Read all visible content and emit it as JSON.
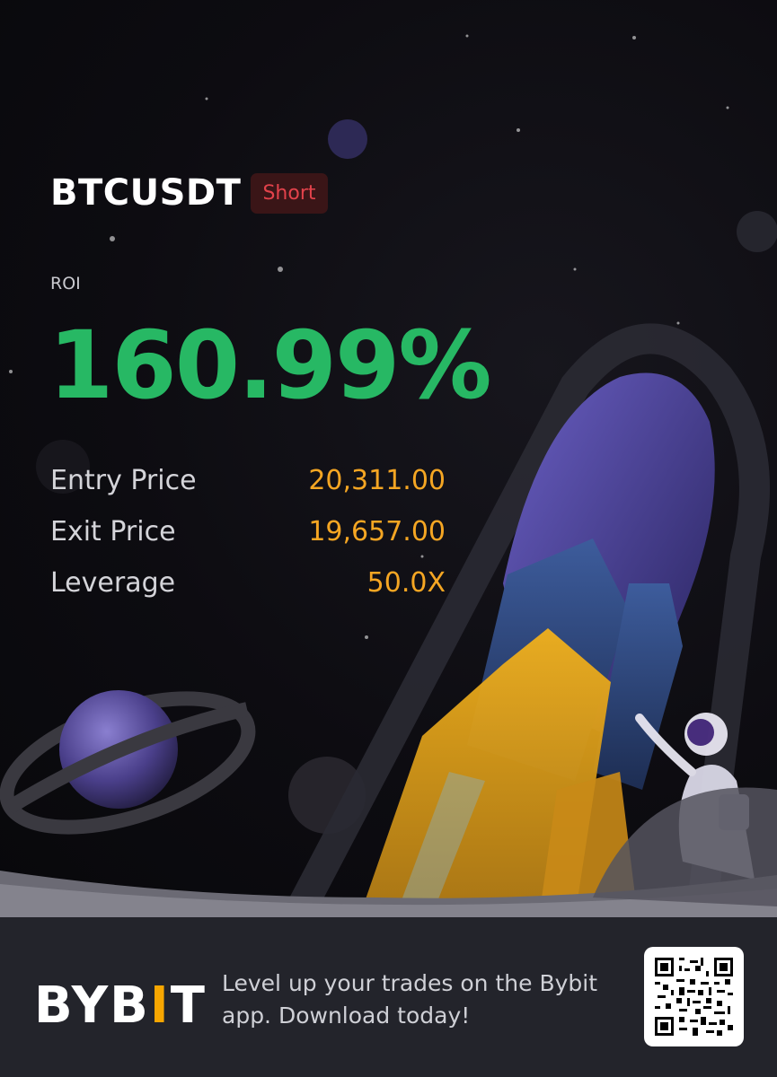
{
  "trade": {
    "symbol": "BTCUSDT",
    "side": "Short",
    "roi_label": "ROI",
    "roi_value": "160.99%"
  },
  "stats": [
    {
      "label": "Entry Price",
      "value": "20,311.00"
    },
    {
      "label": "Exit Price",
      "value": "19,657.00"
    },
    {
      "label": "Leverage",
      "value": "50.0X"
    }
  ],
  "footer": {
    "logo_prefix": "BYB",
    "logo_bar": "I",
    "logo_suffix": "T",
    "tagline": "Level up your trades on the Bybit app. Download today!"
  },
  "colors": {
    "roi_green": "#27b864",
    "value_orange": "#f5a623",
    "short_red": "#e2424b",
    "brand_yellow": "#f7a600"
  },
  "icons": {
    "qr": "qr-code-icon",
    "illustration": "rocket-astronaut-illustration"
  }
}
